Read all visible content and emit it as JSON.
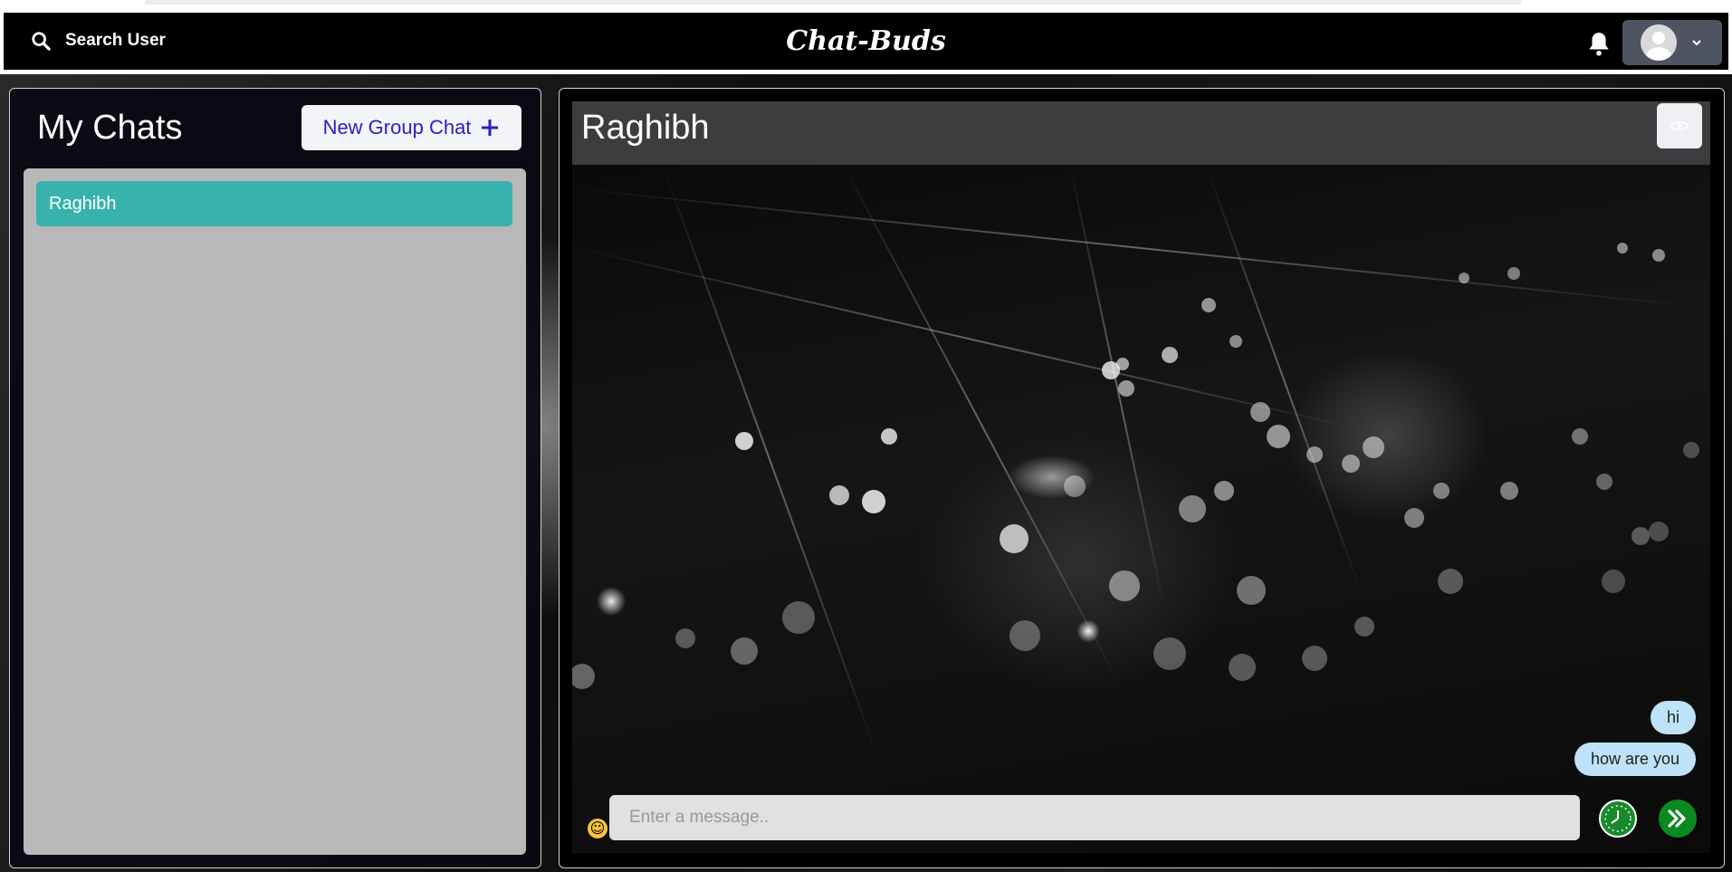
{
  "navbar": {
    "search_label": "Search User",
    "app_title": "Chat-Buds",
    "icons": {
      "search": "search-icon",
      "bell": "bell-icon",
      "avatar": "avatar-icon",
      "chevron": "chevron-down-icon"
    }
  },
  "sidebar": {
    "title": "My Chats",
    "new_group_label": "New Group Chat",
    "chats": [
      {
        "name": "Raghibh",
        "selected": true
      }
    ]
  },
  "chat": {
    "header_name": "Raghibh",
    "messages": [
      {
        "text": "hi",
        "from_me": true
      },
      {
        "text": "how are you",
        "from_me": true
      }
    ],
    "input_placeholder": "Enter a message..",
    "input_value": ""
  },
  "colors": {
    "navbar_bg": "#000000",
    "selected_chat": "#38b2ac",
    "message_bubble": "#bee3f8",
    "send_button": "#0b8a1f",
    "new_group_text": "#2a1fbf"
  }
}
